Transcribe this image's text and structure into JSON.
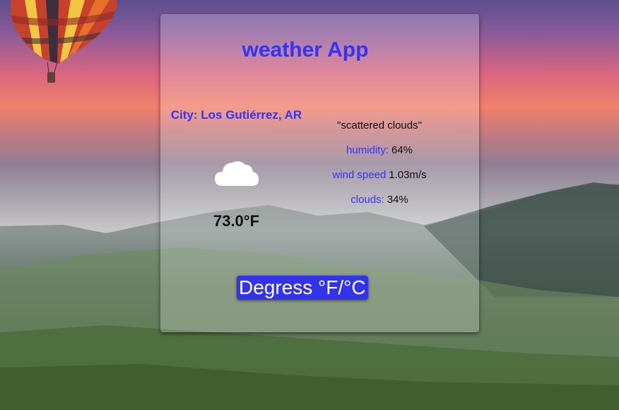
{
  "app": {
    "title": "weather App"
  },
  "weather": {
    "city": "City: Los Gutiérrez, AR",
    "temperature": "73.0°F",
    "icon": "cloud-icon",
    "description": "\"scattered clouds\"",
    "humidity_label": "humidity:",
    "humidity_value": "64%",
    "wind_label": "wind speed",
    "wind_value": "1.03m/s",
    "clouds_label": "clouds:",
    "clouds_value": "34%"
  },
  "controls": {
    "unit_toggle_label": "Degress °F/°C"
  },
  "colors": {
    "accent": "#3333ff",
    "button_bg": "#3333ee",
    "button_text": "#ffffff",
    "value_text": "#111111"
  }
}
